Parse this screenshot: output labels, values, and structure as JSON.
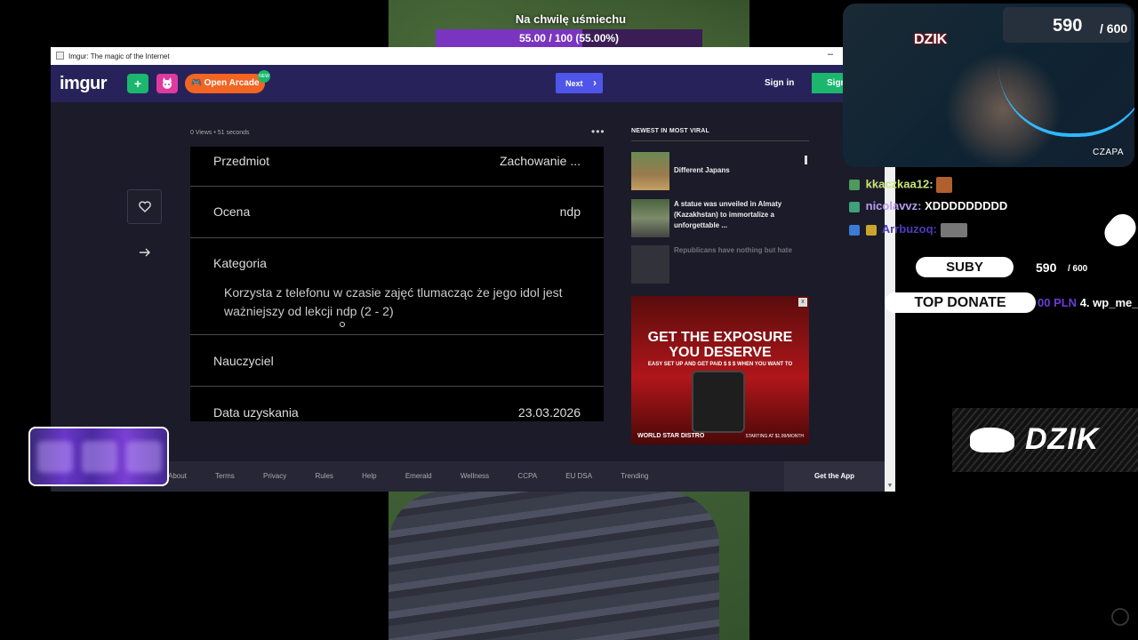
{
  "overlay": {
    "progress_title": "Na chwilę uśmiechu",
    "progress_text": "55.00 / 100 (55.00%)",
    "progress_fraction": 0.55
  },
  "window": {
    "title": "Imgur: The magic of the Internet",
    "minimize": "–"
  },
  "imgur": {
    "logo": "imgur",
    "upload_icon": "+",
    "arcade_label": "Open Arcade",
    "arcade_badge": "NEW",
    "next_label": "Next",
    "next_arrow": "›",
    "sign_in": "Sign in",
    "sign_up": "Sign",
    "meta_views": "0 Views",
    "meta_sep": "•",
    "meta_time": "51 seconds",
    "more": "•••"
  },
  "post": {
    "rows": [
      {
        "key": "Przedmiot",
        "value": "Zachowanie ..."
      },
      {
        "key": "Ocena",
        "value": "ndp"
      },
      {
        "key": "Kategoria",
        "desc": "Korzysta z telefonu w czasie zajęć tlumacząc że jego idol jest ważniejszy od lekcji ndp (2 - 2)"
      },
      {
        "key": "Nauczyciel"
      },
      {
        "key": "Data uzyskania",
        "value": "23.03.2026"
      }
    ]
  },
  "viral": {
    "heading": "NEWEST IN MOST VIRAL",
    "items": [
      {
        "title": "Different Japans"
      },
      {
        "title": "A statue was unveiled in Almaty (Kazakhstan) to immortalize a unforgettable ..."
      },
      {
        "title": "Republicans have nothing but hate"
      }
    ]
  },
  "ad": {
    "headline_1": "GET THE EXPOSURE",
    "headline_2": "YOU DESERVE",
    "sub": "EASY SET UP AND GET PAID $ $ $ WHEN YOU WANT TO",
    "brand": "WORLD STAR DISTRO",
    "price": "STARTING AT $1.99/MONTH",
    "close": "x"
  },
  "footer": {
    "links": [
      "About",
      "Terms",
      "Privacy",
      "Rules",
      "Help",
      "Emerald",
      "Wellness",
      "CCPA",
      "EU DSA",
      "Trending"
    ],
    "get_app": "Get the App",
    "scroll_down": "▼"
  },
  "stream": {
    "cam_logo": "DZIK",
    "cam_count": "590",
    "cam_count_max": "/ 600",
    "cam_name": "CZAPA",
    "chat": [
      {
        "user": "kkaczkaa12:",
        "msg": ""
      },
      {
        "user": "nicolavvz:",
        "msg": "XDDDDDDDDD"
      },
      {
        "user": "Arrbuzoq:",
        "msg": ""
      }
    ],
    "suby_label": "SUBY",
    "suby_count": "590",
    "suby_max": "/ 600",
    "top_donate_label": "TOP DONATE",
    "donate_amount": "00 PLN",
    "donate_user": "4. wp_me_",
    "banner_text": "DZIK"
  },
  "colors": {
    "imgur_nav": "#27235a",
    "imgur_green": "#1bb76e",
    "imgur_next": "#4f55e8",
    "progress_fill": "#7a35c0"
  }
}
